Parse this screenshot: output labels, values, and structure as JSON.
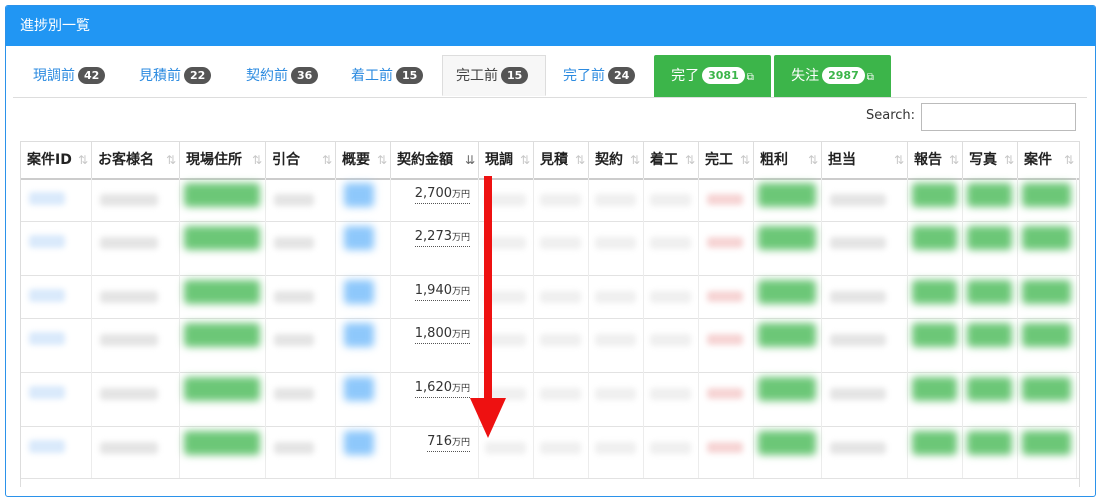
{
  "panel": {
    "title": "進捗別一覧"
  },
  "tabs": [
    {
      "label": "現調前",
      "count": "42"
    },
    {
      "label": "見積前",
      "count": "22"
    },
    {
      "label": "契約前",
      "count": "36"
    },
    {
      "label": "着工前",
      "count": "15"
    },
    {
      "label": "完工前",
      "count": "15"
    },
    {
      "label": "完了前",
      "count": "24"
    },
    {
      "label": "完了",
      "count": "3081"
    },
    {
      "label": "失注",
      "count": "2987"
    }
  ],
  "search": {
    "label": "Search:",
    "value": ""
  },
  "table": {
    "headers": [
      "案件ID",
      "お客様名",
      "現場住所",
      "引合",
      "概要",
      "契約金額",
      "現調",
      "見積",
      "契約",
      "着工",
      "完工",
      "粗利",
      "担当",
      "報告",
      "写真",
      "案件"
    ],
    "unit": "万円",
    "amounts": [
      "2,700",
      "2,273",
      "1,940",
      "1,800",
      "1,620",
      "716"
    ]
  },
  "colors": {
    "header": "#2196f3",
    "tab_link": "#2c8be0",
    "green_tab": "#3cb54a",
    "arrow": "#ee1111"
  },
  "icons": {
    "sort": "sort-icon",
    "external": "external-link-icon",
    "arrow": "down-arrow-icon"
  }
}
